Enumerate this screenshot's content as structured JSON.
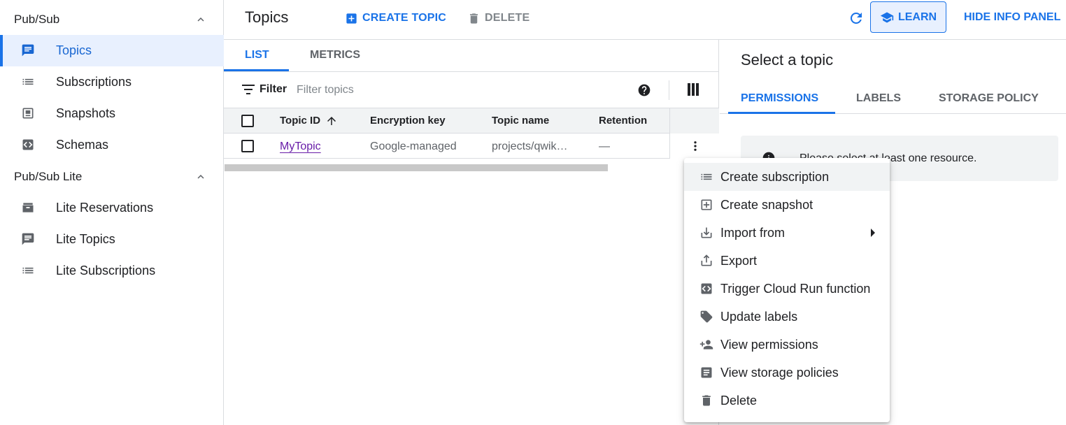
{
  "sidebar": {
    "sections": [
      {
        "title": "Pub/Sub",
        "items": [
          {
            "label": "Topics",
            "icon": "message-icon",
            "active": true
          },
          {
            "label": "Subscriptions",
            "icon": "list-icon"
          },
          {
            "label": "Snapshots",
            "icon": "snapshot-icon"
          },
          {
            "label": "Schemas",
            "icon": "code-icon"
          }
        ]
      },
      {
        "title": "Pub/Sub Lite",
        "items": [
          {
            "label": "Lite Reservations",
            "icon": "reservation-icon"
          },
          {
            "label": "Lite Topics",
            "icon": "message-icon"
          },
          {
            "label": "Lite Subscriptions",
            "icon": "list-icon"
          }
        ]
      }
    ]
  },
  "header": {
    "title": "Topics",
    "create_label": "CREATE TOPIC",
    "delete_label": "DELETE",
    "learn_label": "LEARN",
    "hide_info_label": "HIDE INFO PANEL"
  },
  "tabs": [
    {
      "label": "LIST",
      "active": true
    },
    {
      "label": "METRICS"
    }
  ],
  "filter": {
    "label": "Filter",
    "placeholder": "Filter topics"
  },
  "table": {
    "columns": [
      "Topic ID",
      "Encryption key",
      "Topic name",
      "Retention"
    ],
    "rows": [
      {
        "topic_id": "MyTopic",
        "encryption": "Google-managed",
        "topic_name": "projects/qwik…",
        "retention": "—"
      }
    ]
  },
  "info_panel": {
    "title": "Select a topic",
    "tabs": [
      {
        "label": "PERMISSIONS",
        "active": true
      },
      {
        "label": "LABELS"
      },
      {
        "label": "STORAGE POLICY"
      }
    ],
    "message": "Please select at least one resource."
  },
  "context_menu": {
    "items": [
      {
        "label": "Create subscription",
        "icon": "list-icon",
        "hover": true
      },
      {
        "label": "Create snapshot",
        "icon": "add-box-icon"
      },
      {
        "label": "Import from",
        "icon": "download-icon",
        "submenu": true
      },
      {
        "label": "Export",
        "icon": "upload-icon"
      },
      {
        "label": "Trigger Cloud Run function",
        "icon": "code-icon"
      },
      {
        "label": "Update labels",
        "icon": "label-icon"
      },
      {
        "label": "View permissions",
        "icon": "person-add-icon"
      },
      {
        "label": "View storage policies",
        "icon": "document-icon"
      },
      {
        "label": "Delete",
        "icon": "trash-icon"
      }
    ]
  },
  "colors": {
    "accent": "#1a73e8",
    "active_nav_bg": "#e8f0fe",
    "link_visited": "#681da8"
  }
}
